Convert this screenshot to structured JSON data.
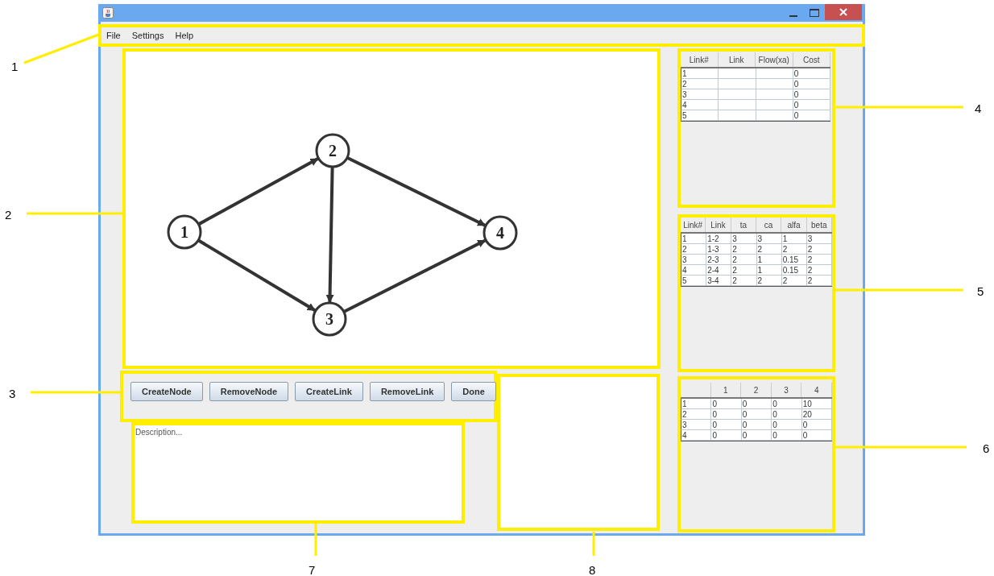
{
  "menu": [
    "File",
    "Settings",
    "Help"
  ],
  "graph": {
    "nodes": [
      {
        "label": "1"
      },
      {
        "label": "2"
      },
      {
        "label": "3"
      },
      {
        "label": "4"
      }
    ]
  },
  "buttons": [
    "CreateNode",
    "RemoveNode",
    "CreateLink",
    "RemoveLink",
    "Done"
  ],
  "description": {
    "placeholder": "Description..."
  },
  "flow_table": {
    "columns": [
      "Link#",
      "Link",
      "Flow(xa)",
      "Cost"
    ],
    "rows": [
      {
        "link_number": "1",
        "cost": "0"
      },
      {
        "link_number": "2",
        "cost": "0"
      },
      {
        "link_number": "3",
        "cost": "0"
      },
      {
        "link_number": "4",
        "cost": "0"
      },
      {
        "link_number": "5",
        "cost": "0"
      }
    ]
  },
  "link_table": {
    "columns": [
      "Link#",
      "Link",
      "ta",
      "ca",
      "alfa",
      "beta"
    ],
    "rows": [
      [
        "1",
        "1-2",
        "3",
        "3",
        "1",
        "3"
      ],
      [
        "2",
        "1-3",
        "2",
        "2",
        "2",
        "2"
      ],
      [
        "3",
        "2-3",
        "2",
        "1",
        "0.15",
        "2"
      ],
      [
        "4",
        "2-4",
        "2",
        "1",
        "0.15",
        "2"
      ],
      [
        "5",
        "3-4",
        "2",
        "2",
        "2",
        "2"
      ]
    ]
  },
  "od_table": {
    "columns": [
      "1",
      "2",
      "3",
      "4"
    ],
    "rows": [
      {
        "label": "1",
        "cells": [
          "0",
          "0",
          "0",
          "10"
        ]
      },
      {
        "label": "2",
        "cells": [
          "0",
          "0",
          "0",
          "20"
        ]
      },
      {
        "label": "3",
        "cells": [
          "0",
          "0",
          "0",
          "0"
        ]
      },
      {
        "label": "4",
        "cells": [
          "0",
          "0",
          "0",
          "0"
        ]
      }
    ]
  },
  "callouts": [
    "1",
    "2",
    "3",
    "4",
    "5",
    "6",
    "7",
    "8"
  ]
}
